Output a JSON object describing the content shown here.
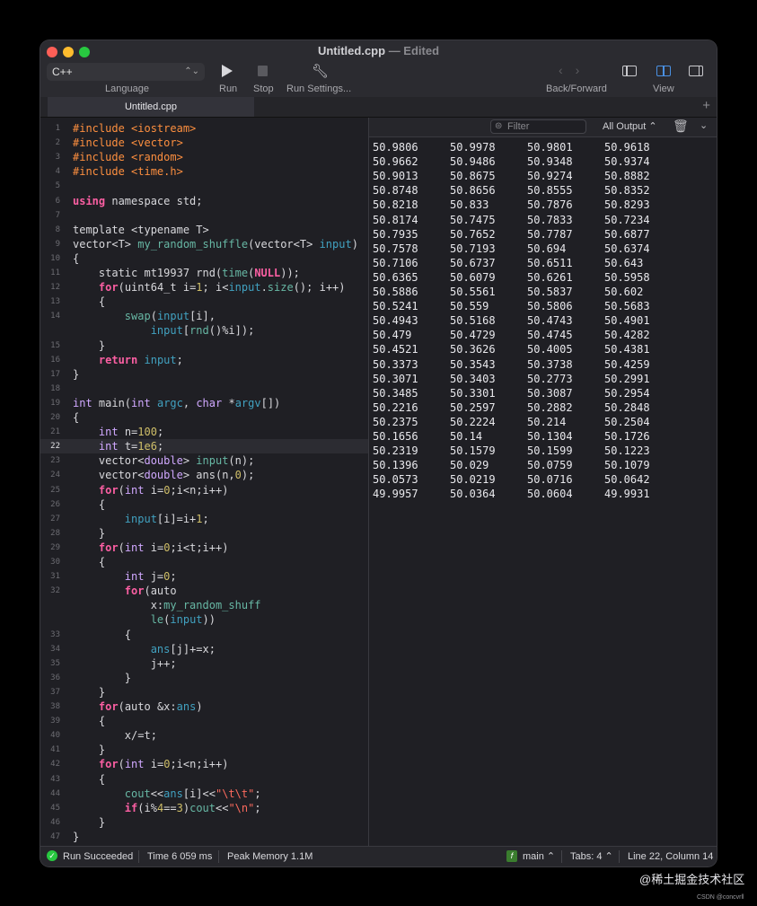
{
  "window": {
    "title": "Untitled.cpp",
    "title_suffix": "—  Edited"
  },
  "toolbar": {
    "language_value": "C++",
    "language_label": "Language",
    "run_label": "Run",
    "stop_label": "Stop",
    "run_settings_label": "Run Settings...",
    "back_forward_label": "Back/Forward",
    "view_label": "View"
  },
  "tabs": [
    {
      "label": "Untitled.cpp"
    }
  ],
  "console": {
    "filter_placeholder": "Filter",
    "output_select": "All Output ⌃",
    "rows": [
      [
        "50.9806",
        "50.9978",
        "50.9801",
        "50.9618"
      ],
      [
        "50.9662",
        "50.9486",
        "50.9348",
        "50.9374"
      ],
      [
        "50.9013",
        "50.8675",
        "50.9274",
        "50.8882"
      ],
      [
        "50.8748",
        "50.8656",
        "50.8555",
        "50.8352"
      ],
      [
        "50.8218",
        "50.833",
        "50.7876",
        "50.8293"
      ],
      [
        "50.8174",
        "50.7475",
        "50.7833",
        "50.7234"
      ],
      [
        "50.7935",
        "50.7652",
        "50.7787",
        "50.6877"
      ],
      [
        "50.7578",
        "50.7193",
        "50.694",
        "50.6374"
      ],
      [
        "50.7106",
        "50.6737",
        "50.6511",
        "50.643"
      ],
      [
        "50.6365",
        "50.6079",
        "50.6261",
        "50.5958"
      ],
      [
        "50.5886",
        "50.5561",
        "50.5837",
        "50.602"
      ],
      [
        "50.5241",
        "50.559",
        "50.5806",
        "50.5683"
      ],
      [
        "50.4943",
        "50.5168",
        "50.4743",
        "50.4901"
      ],
      [
        "50.479",
        "50.4729",
        "50.4745",
        "50.4282"
      ],
      [
        "50.4521",
        "50.3626",
        "50.4005",
        "50.4381"
      ],
      [
        "50.3373",
        "50.3543",
        "50.3738",
        "50.4259"
      ],
      [
        "50.3071",
        "50.3403",
        "50.2773",
        "50.2991"
      ],
      [
        "50.3485",
        "50.3301",
        "50.3087",
        "50.2954"
      ],
      [
        "50.2216",
        "50.2597",
        "50.2882",
        "50.2848"
      ],
      [
        "50.2375",
        "50.2224",
        "50.214",
        "50.2504"
      ],
      [
        "50.1656",
        "50.14",
        "50.1304",
        "50.1726"
      ],
      [
        "50.2319",
        "50.1579",
        "50.1599",
        "50.1223"
      ],
      [
        "50.1396",
        "50.029",
        "50.0759",
        "50.1079"
      ],
      [
        "50.0573",
        "50.0219",
        "50.0716",
        "50.0642"
      ],
      [
        "49.9957",
        "50.0364",
        "50.0604",
        "49.9931"
      ]
    ]
  },
  "code": [
    {
      "n": "1",
      "parts": [
        [
          "pp",
          "#include "
        ],
        [
          "pp",
          "<iostream>"
        ]
      ]
    },
    {
      "n": "2",
      "parts": [
        [
          "pp",
          "#include "
        ],
        [
          "pp",
          "<vector>"
        ]
      ]
    },
    {
      "n": "3",
      "parts": [
        [
          "pp",
          "#include "
        ],
        [
          "pp",
          "<random>"
        ]
      ]
    },
    {
      "n": "4",
      "parts": [
        [
          "pp",
          "#include "
        ],
        [
          "pp",
          "<time.h>"
        ]
      ]
    },
    {
      "n": "5",
      "parts": []
    },
    {
      "n": "6",
      "parts": [
        [
          "kw",
          "using"
        ],
        [
          "tx",
          " namespace "
        ],
        [
          "tx",
          "std;"
        ]
      ]
    },
    {
      "n": "7",
      "parts": []
    },
    {
      "n": "8",
      "parts": [
        [
          "tx",
          "template <typename T>"
        ]
      ]
    },
    {
      "n": "9",
      "parts": [
        [
          "tx",
          "vector<T> "
        ],
        [
          "fn",
          "my_random_shuffle"
        ],
        [
          "tx",
          "(vector<T> "
        ],
        [
          "id",
          "input"
        ],
        [
          "tx",
          ")"
        ]
      ]
    },
    {
      "n": "10",
      "parts": [
        [
          "tx",
          "{"
        ]
      ]
    },
    {
      "n": "11",
      "parts": [
        [
          "tx",
          "    static mt19937 rnd("
        ],
        [
          "fn",
          "time"
        ],
        [
          "tx",
          "("
        ],
        [
          "kw",
          "NULL"
        ],
        [
          "tx",
          "));"
        ]
      ]
    },
    {
      "n": "12",
      "parts": [
        [
          "tx",
          "    "
        ],
        [
          "kw",
          "for"
        ],
        [
          "tx",
          "(uint64_t i="
        ],
        [
          "num",
          "1"
        ],
        [
          "tx",
          "; i<"
        ],
        [
          "id",
          "input"
        ],
        [
          "tx",
          "."
        ],
        [
          "fn",
          "size"
        ],
        [
          "tx",
          "(); i++)"
        ]
      ]
    },
    {
      "n": "13",
      "parts": [
        [
          "tx",
          "    {"
        ]
      ]
    },
    {
      "n": "14",
      "parts": [
        [
          "tx",
          "        "
        ],
        [
          "fn",
          "swap"
        ],
        [
          "tx",
          "("
        ],
        [
          "id",
          "input"
        ],
        [
          "tx",
          "[i],"
        ]
      ]
    },
    {
      "n": "",
      "parts": [
        [
          "tx",
          "            "
        ],
        [
          "id",
          "input"
        ],
        [
          "tx",
          "["
        ],
        [
          "fn",
          "rnd"
        ],
        [
          "tx",
          "()%i]);"
        ]
      ]
    },
    {
      "n": "15",
      "parts": [
        [
          "tx",
          "    }"
        ]
      ]
    },
    {
      "n": "16",
      "parts": [
        [
          "tx",
          "    "
        ],
        [
          "kw",
          "return"
        ],
        [
          "tx",
          " "
        ],
        [
          "id",
          "input"
        ],
        [
          "tx",
          ";"
        ]
      ]
    },
    {
      "n": "17",
      "parts": [
        [
          "tx",
          "}"
        ]
      ]
    },
    {
      "n": "18",
      "parts": []
    },
    {
      "n": "19",
      "parts": [
        [
          "ty",
          "int"
        ],
        [
          "tx",
          " main("
        ],
        [
          "ty",
          "int"
        ],
        [
          "tx",
          " "
        ],
        [
          "id",
          "argc"
        ],
        [
          "tx",
          ", "
        ],
        [
          "ty",
          "char"
        ],
        [
          "tx",
          " *"
        ],
        [
          "id",
          "argv"
        ],
        [
          "tx",
          "[])"
        ]
      ]
    },
    {
      "n": "20",
      "parts": [
        [
          "tx",
          "{"
        ]
      ]
    },
    {
      "n": "21",
      "parts": [
        [
          "tx",
          "    "
        ],
        [
          "ty",
          "int"
        ],
        [
          "tx",
          " n="
        ],
        [
          "num",
          "100"
        ],
        [
          "tx",
          ";"
        ]
      ]
    },
    {
      "n": "22",
      "current": true,
      "parts": [
        [
          "tx",
          "    "
        ],
        [
          "ty",
          "int"
        ],
        [
          "tx",
          " t="
        ],
        [
          "num",
          "1e6"
        ],
        [
          "tx",
          ";"
        ]
      ]
    },
    {
      "n": "23",
      "parts": [
        [
          "tx",
          "    vector<"
        ],
        [
          "ty",
          "double"
        ],
        [
          "tx",
          "> "
        ],
        [
          "fn",
          "input"
        ],
        [
          "tx",
          "(n);"
        ]
      ]
    },
    {
      "n": "24",
      "parts": [
        [
          "tx",
          "    vector<"
        ],
        [
          "ty",
          "double"
        ],
        [
          "tx",
          "> ans(n,"
        ],
        [
          "num",
          "0"
        ],
        [
          "tx",
          ");"
        ]
      ]
    },
    {
      "n": "25",
      "parts": [
        [
          "tx",
          "    "
        ],
        [
          "kw",
          "for"
        ],
        [
          "tx",
          "("
        ],
        [
          "ty",
          "int"
        ],
        [
          "tx",
          " i="
        ],
        [
          "num",
          "0"
        ],
        [
          "tx",
          ";i<n;i++)"
        ]
      ]
    },
    {
      "n": "26",
      "parts": [
        [
          "tx",
          "    {"
        ]
      ]
    },
    {
      "n": "27",
      "parts": [
        [
          "tx",
          "        "
        ],
        [
          "id",
          "input"
        ],
        [
          "tx",
          "[i]=i+"
        ],
        [
          "num",
          "1"
        ],
        [
          "tx",
          ";"
        ]
      ]
    },
    {
      "n": "28",
      "parts": [
        [
          "tx",
          "    }"
        ]
      ]
    },
    {
      "n": "29",
      "parts": [
        [
          "tx",
          "    "
        ],
        [
          "kw",
          "for"
        ],
        [
          "tx",
          "("
        ],
        [
          "ty",
          "int"
        ],
        [
          "tx",
          " i="
        ],
        [
          "num",
          "0"
        ],
        [
          "tx",
          ";i<t;i++)"
        ]
      ]
    },
    {
      "n": "30",
      "parts": [
        [
          "tx",
          "    {"
        ]
      ]
    },
    {
      "n": "31",
      "parts": [
        [
          "tx",
          "        "
        ],
        [
          "ty",
          "int"
        ],
        [
          "tx",
          " j="
        ],
        [
          "num",
          "0"
        ],
        [
          "tx",
          ";"
        ]
      ]
    },
    {
      "n": "32",
      "parts": [
        [
          "tx",
          "        "
        ],
        [
          "kw",
          "for"
        ],
        [
          "tx",
          "(auto"
        ]
      ]
    },
    {
      "n": "",
      "parts": [
        [
          "tx",
          "            x:"
        ],
        [
          "fn",
          "my_random_shuff"
        ]
      ]
    },
    {
      "n": "",
      "parts": [
        [
          "fn",
          "            le"
        ],
        [
          "tx",
          "("
        ],
        [
          "id",
          "input"
        ],
        [
          "tx",
          "))"
        ]
      ]
    },
    {
      "n": "33",
      "parts": [
        [
          "tx",
          "        {"
        ]
      ]
    },
    {
      "n": "34",
      "parts": [
        [
          "tx",
          "            "
        ],
        [
          "id",
          "ans"
        ],
        [
          "tx",
          "[j]+=x;"
        ]
      ]
    },
    {
      "n": "35",
      "parts": [
        [
          "tx",
          "            j++;"
        ]
      ]
    },
    {
      "n": "36",
      "parts": [
        [
          "tx",
          "        }"
        ]
      ]
    },
    {
      "n": "37",
      "parts": [
        [
          "tx",
          "    }"
        ]
      ]
    },
    {
      "n": "38",
      "parts": [
        [
          "tx",
          "    "
        ],
        [
          "kw",
          "for"
        ],
        [
          "tx",
          "(auto &x:"
        ],
        [
          "id",
          "ans"
        ],
        [
          "tx",
          ")"
        ]
      ]
    },
    {
      "n": "39",
      "parts": [
        [
          "tx",
          "    {"
        ]
      ]
    },
    {
      "n": "40",
      "parts": [
        [
          "tx",
          "        x/=t;"
        ]
      ]
    },
    {
      "n": "41",
      "parts": [
        [
          "tx",
          "    }"
        ]
      ]
    },
    {
      "n": "42",
      "parts": [
        [
          "tx",
          "    "
        ],
        [
          "kw",
          "for"
        ],
        [
          "tx",
          "("
        ],
        [
          "ty",
          "int"
        ],
        [
          "tx",
          " i="
        ],
        [
          "num",
          "0"
        ],
        [
          "tx",
          ";i<n;i++)"
        ]
      ]
    },
    {
      "n": "43",
      "parts": [
        [
          "tx",
          "    {"
        ]
      ]
    },
    {
      "n": "44",
      "parts": [
        [
          "tx",
          "        "
        ],
        [
          "fn",
          "cout"
        ],
        [
          "tx",
          "<<"
        ],
        [
          "id",
          "ans"
        ],
        [
          "tx",
          "[i]<<"
        ],
        [
          "str",
          "\"\\t\\t\""
        ],
        [
          "tx",
          ";"
        ]
      ]
    },
    {
      "n": "45",
      "parts": [
        [
          "tx",
          "        "
        ],
        [
          "kw",
          "if"
        ],
        [
          "tx",
          "(i%"
        ],
        [
          "num",
          "4"
        ],
        [
          "tx",
          "=="
        ],
        [
          "num",
          "3"
        ],
        [
          "tx",
          ")"
        ],
        [
          "fn",
          "cout"
        ],
        [
          "tx",
          "<<"
        ],
        [
          "str",
          "\"\\n\""
        ],
        [
          "tx",
          ";"
        ]
      ]
    },
    {
      "n": "46",
      "parts": [
        [
          "tx",
          "    }"
        ]
      ]
    },
    {
      "n": "47",
      "parts": [
        [
          "tx",
          "}"
        ]
      ]
    }
  ],
  "status": {
    "run_result": "Run Succeeded",
    "time": "Time 6 059 ms",
    "memory": "Peak Memory 1.1M",
    "branch": "main ⌃",
    "tabs": "Tabs: 4 ⌃",
    "position": "Line 22, Column 14"
  },
  "watermark": "@稀土掘金技术社区",
  "watermark_small": "CSDN @concvrll"
}
